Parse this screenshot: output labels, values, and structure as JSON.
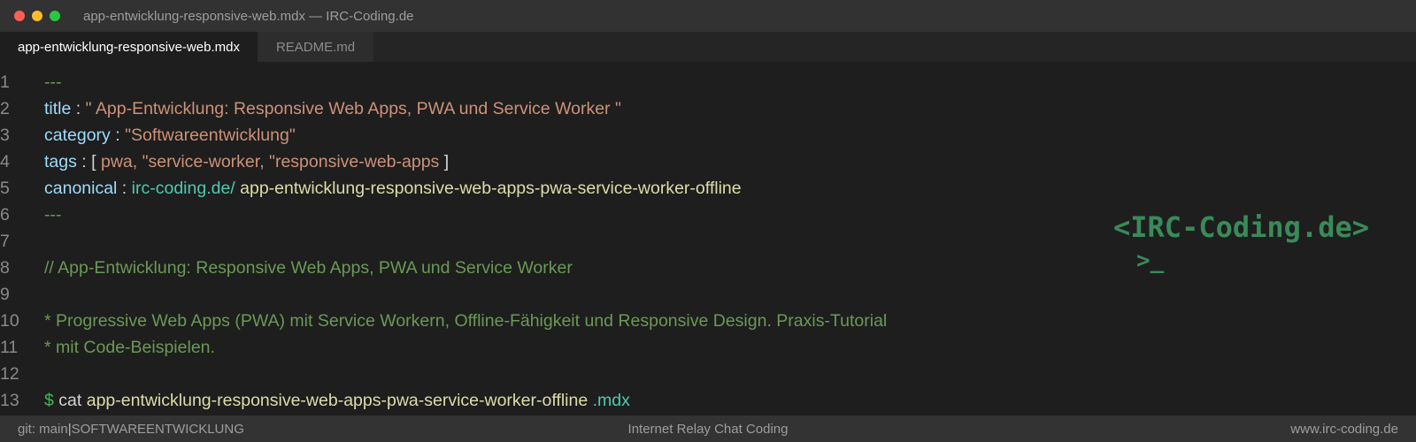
{
  "window": {
    "title": "app-entwicklung-responsive-web.mdx — IRC-Coding.de"
  },
  "tabs": [
    {
      "label": "app-entwicklung-responsive-web.mdx",
      "active": true
    },
    {
      "label": "README.md",
      "active": false
    }
  ],
  "editor": {
    "lines": [
      {
        "number": "1",
        "dashes": "---"
      },
      {
        "number": "2",
        "key": "title",
        "colon": " : ",
        "value": "\" App-Entwicklung: Responsive Web Apps, PWA und Service Worker \""
      },
      {
        "number": "3",
        "key": "category",
        "colon": " : ",
        "value": "\"Softwareentwicklung\""
      },
      {
        "number": "4",
        "key": "tags",
        "colon": " : ",
        "open": "[ ",
        "value": "pwa, \"service-worker, \"responsive-web-apps",
        "close": " ]"
      },
      {
        "number": "5",
        "key": "canonical",
        "colon": " : ",
        "domain": "irc-coding.de/",
        "path": " app-entwicklung-responsive-web-apps-pwa-service-worker-offline"
      },
      {
        "number": "6",
        "dashes": "---"
      },
      {
        "number": "7"
      },
      {
        "number": "8",
        "comment": "// App-Entwicklung: Responsive Web Apps, PWA und Service Worker"
      },
      {
        "number": "9"
      },
      {
        "number": "10",
        "comment": "* Progressive Web Apps (PWA) mit Service Workern, Offline-Fähigkeit und Responsive Design. Praxis-Tutorial"
      },
      {
        "number": "11",
        "comment": "* mit Code-Beispielen."
      },
      {
        "number": "12"
      },
      {
        "number": "13",
        "prompt": "$",
        "command": " cat ",
        "file": "app-entwicklung-responsive-web-apps-pwa-service-worker-offline",
        "ext": " .mdx"
      }
    ]
  },
  "logo": {
    "text": "<IRC-Coding.de>",
    "cursor": ">_"
  },
  "statusbar": {
    "branch": "git: main",
    "separator": "|",
    "category": "SOFTWAREENTWICKLUNG",
    "center": "Internet Relay Chat Coding",
    "right": "www.irc-coding.de"
  },
  "colors": {
    "background": "#1e1e1e",
    "key": "#9cdcfe",
    "string": "#ce9178",
    "comment": "#6a9955",
    "teal": "#4ec9b0",
    "path": "#dcdcaa",
    "logo": "#3a8a5a"
  }
}
